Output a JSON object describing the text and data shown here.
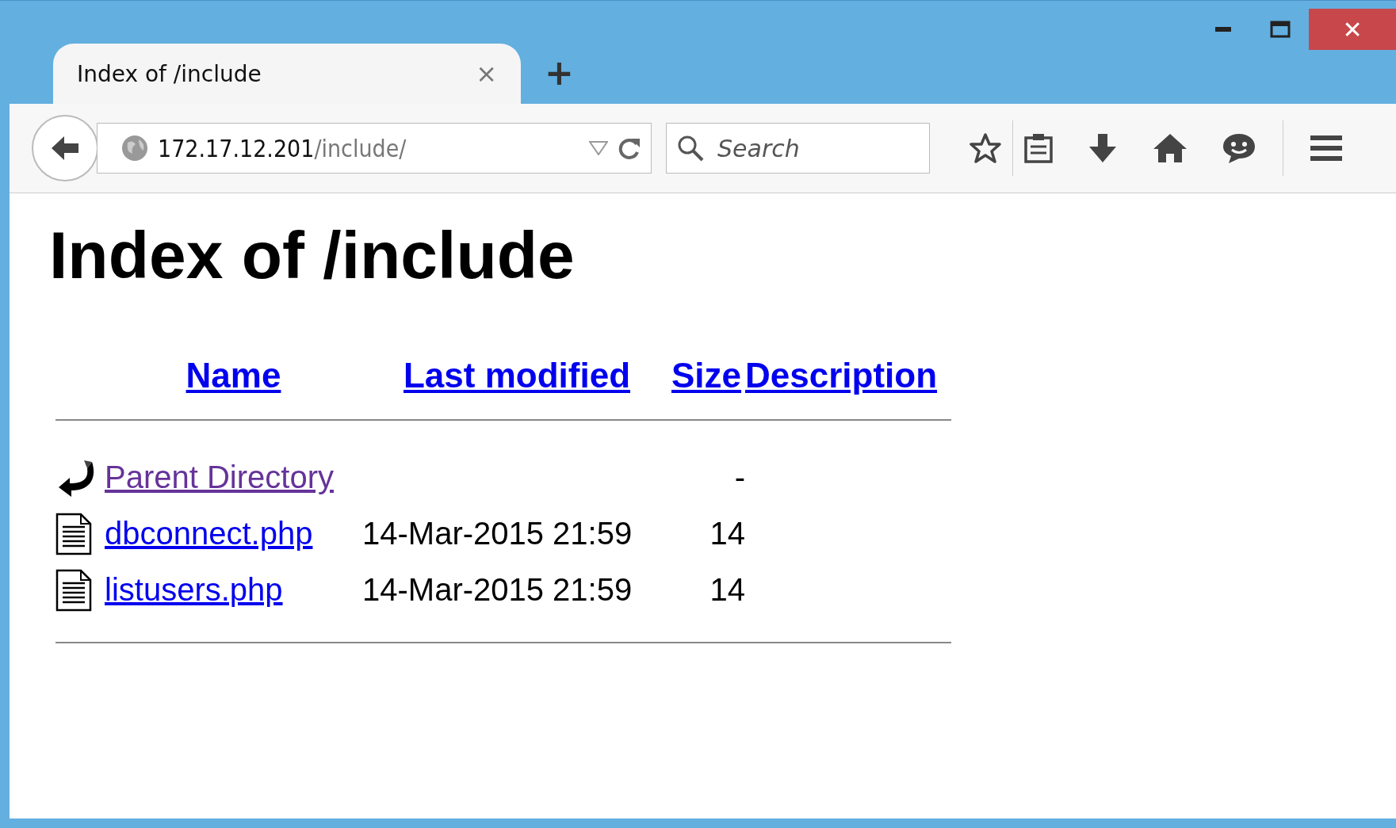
{
  "tab": {
    "title": "Index of /include",
    "close": "×",
    "selected": true
  },
  "new_tab": "+",
  "window_controls": {
    "close": "✕"
  },
  "address_bar": {
    "host": "172.17.12.201",
    "path": "/include/"
  },
  "search": {
    "placeholder": "Search"
  },
  "page": {
    "heading": "Index of /include",
    "columns": [
      "Name",
      "Last modified",
      "Size",
      "Description"
    ],
    "rows": [
      {
        "kind": "parent",
        "name": "Parent Directory",
        "visited": true,
        "modified": "",
        "size": "-"
      },
      {
        "kind": "file",
        "name": "dbconnect.php",
        "visited": false,
        "modified": "14-Mar-2015 21:59",
        "size": "14"
      },
      {
        "kind": "file",
        "name": "listusers.php",
        "visited": false,
        "modified": "14-Mar-2015 21:59",
        "size": "14"
      }
    ]
  }
}
